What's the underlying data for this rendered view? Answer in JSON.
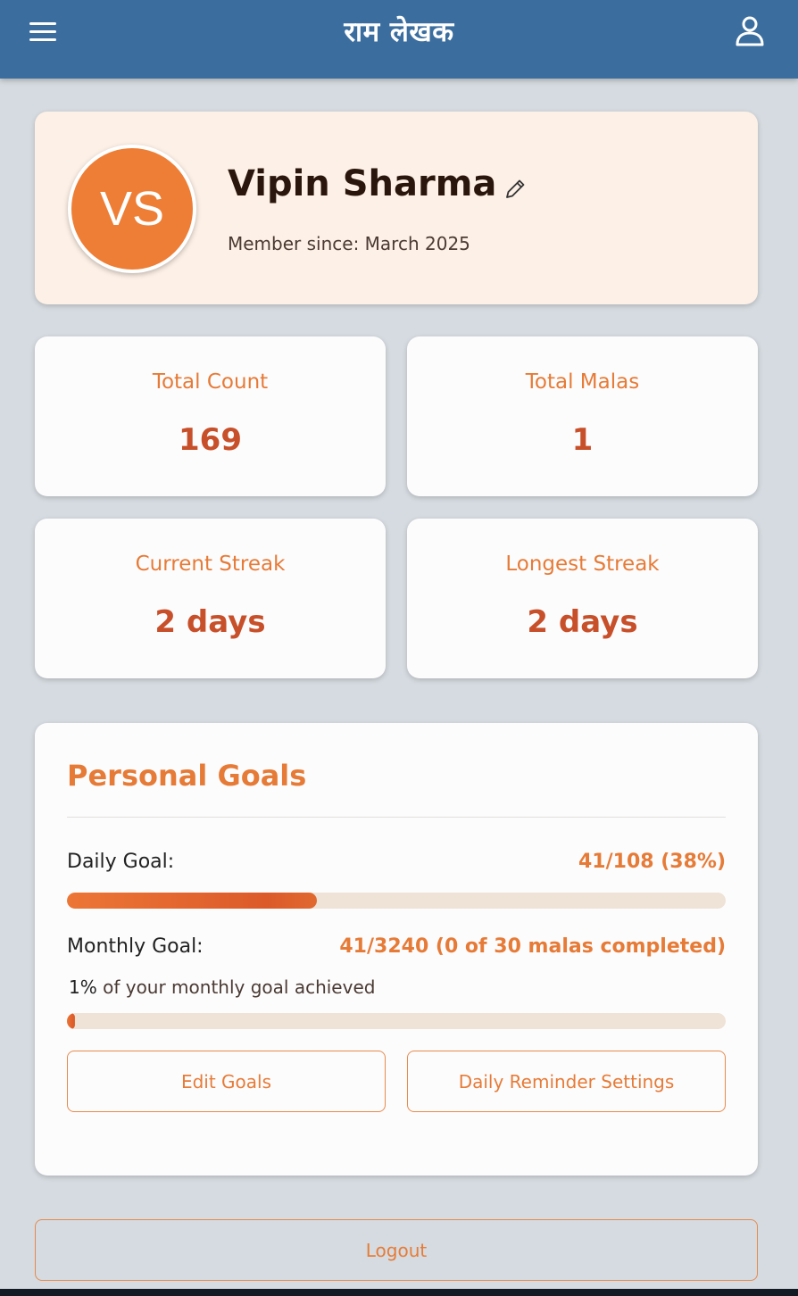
{
  "appbar": {
    "title": "राम लेखक",
    "menu_icon": "hamburger-menu-icon",
    "profile_icon": "person-icon",
    "bg_color": "#3b6e9e"
  },
  "profile": {
    "initials": "VS",
    "name": "Vipin Sharma",
    "member_since": "Member since: March 2025",
    "edit_icon": "pencil-icon",
    "avatar_color": "#ee7e35"
  },
  "stats": [
    {
      "label": "Total Count",
      "value": "169"
    },
    {
      "label": "Total Malas",
      "value": "1"
    },
    {
      "label": "Current Streak",
      "value": "2 days"
    },
    {
      "label": "Longest Streak",
      "value": "2 days"
    }
  ],
  "goals": {
    "title": "Personal Goals",
    "daily": {
      "label": "Daily Goal:",
      "value": "41/108 (38%)",
      "progress": 0.38
    },
    "monthly": {
      "label": "Monthly Goal:",
      "value": "41/3240 (0 of 30 malas completed)",
      "note_percent": "1%",
      "note_text": " of your monthly goal achieved",
      "progress": 0.01
    },
    "edit_label": "Edit Goals",
    "reminder_label": "Daily Reminder Settings"
  },
  "logout_label": "Logout",
  "colors": {
    "accent": "#e67b37",
    "value": "#c7502a",
    "progress_track": "#efe2d6"
  }
}
